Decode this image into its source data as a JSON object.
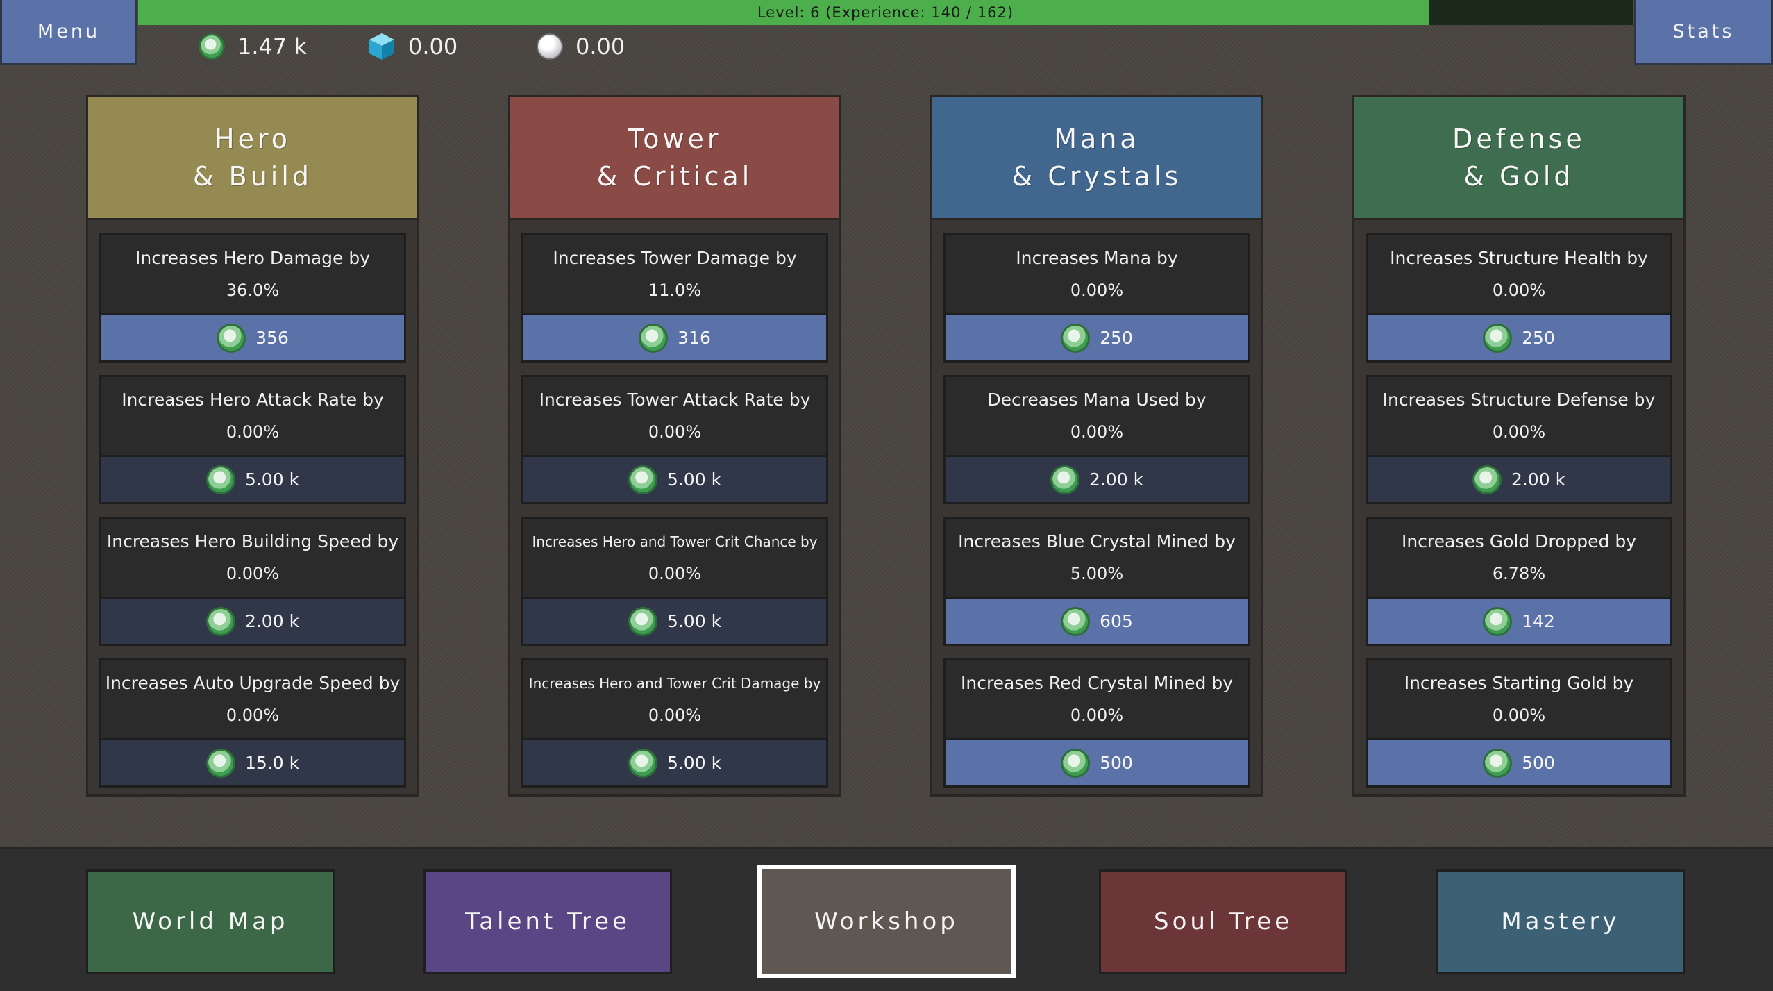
{
  "top": {
    "menu_label": "Menu",
    "stats_label": "Stats",
    "xp_text": "Level: 6  (Experience: 140 / 162)",
    "xp_progress": 0.864
  },
  "currencies": [
    {
      "icon": "green-coin-icon",
      "value": "1.47 k"
    },
    {
      "icon": "blue-crystal-icon",
      "value": "0.00"
    },
    {
      "icon": "white-orb-icon",
      "value": "0.00"
    }
  ],
  "colors": {
    "hero": "#948a52",
    "tower": "#8a4b47",
    "mana": "#41678e",
    "defense": "#3f6d4f",
    "cost_affordable": "#5a72a8",
    "cost_locked": "#2f3748",
    "xp_fill": "#4caf4c"
  },
  "panels": [
    {
      "title1": "Hero",
      "title2": "& Build",
      "upgrades": [
        {
          "desc": "Increases Hero Damage by",
          "value": "36.0%",
          "cost": "356",
          "affordable": true
        },
        {
          "desc": "Increases Hero Attack Rate by",
          "value": "0.00%",
          "cost": "5.00 k",
          "affordable": false
        },
        {
          "desc": "Increases Hero Building Speed by",
          "value": "0.00%",
          "cost": "2.00 k",
          "affordable": false
        },
        {
          "desc": "Increases Auto Upgrade Speed by",
          "value": "0.00%",
          "cost": "15.0 k",
          "affordable": false
        }
      ]
    },
    {
      "title1": "Tower",
      "title2": "& Critical",
      "upgrades": [
        {
          "desc": "Increases Tower Damage by",
          "value": "11.0%",
          "cost": "316",
          "affordable": true
        },
        {
          "desc": "Increases Tower Attack Rate by",
          "value": "0.00%",
          "cost": "5.00 k",
          "affordable": false
        },
        {
          "desc": "Increases Hero and Tower Crit Chance by",
          "value": "0.00%",
          "cost": "5.00 k",
          "affordable": false
        },
        {
          "desc": "Increases Hero and Tower Crit Damage by",
          "value": "0.00%",
          "cost": "5.00 k",
          "affordable": false
        }
      ]
    },
    {
      "title1": "Mana",
      "title2": "& Crystals",
      "upgrades": [
        {
          "desc": "Increases Mana by",
          "value": "0.00%",
          "cost": "250",
          "affordable": true
        },
        {
          "desc": "Decreases Mana Used by",
          "value": "0.00%",
          "cost": "2.00 k",
          "affordable": false
        },
        {
          "desc": "Increases Blue Crystal Mined by",
          "value": "5.00%",
          "cost": "605",
          "affordable": true
        },
        {
          "desc": "Increases Red Crystal Mined by",
          "value": "0.00%",
          "cost": "500",
          "affordable": true
        }
      ]
    },
    {
      "title1": "Defense",
      "title2": "& Gold",
      "upgrades": [
        {
          "desc": "Increases Structure Health by",
          "value": "0.00%",
          "cost": "250",
          "affordable": true
        },
        {
          "desc": "Increases Structure Defense by",
          "value": "0.00%",
          "cost": "2.00 k",
          "affordable": false
        },
        {
          "desc": "Increases Gold Dropped by",
          "value": "6.78%",
          "cost": "142",
          "affordable": true
        },
        {
          "desc": "Increases Starting Gold by",
          "value": "0.00%",
          "cost": "500",
          "affordable": true
        }
      ]
    }
  ],
  "nav": [
    {
      "label": "World Map",
      "color": "#3c6848"
    },
    {
      "label": "Talent Tree",
      "color": "#5a4684"
    },
    {
      "label": "Workshop",
      "color": "#5f5751",
      "active": true
    },
    {
      "label": "Soul Tree",
      "color": "#6c3537"
    },
    {
      "label": "Mastery",
      "color": "#3c6175"
    }
  ]
}
